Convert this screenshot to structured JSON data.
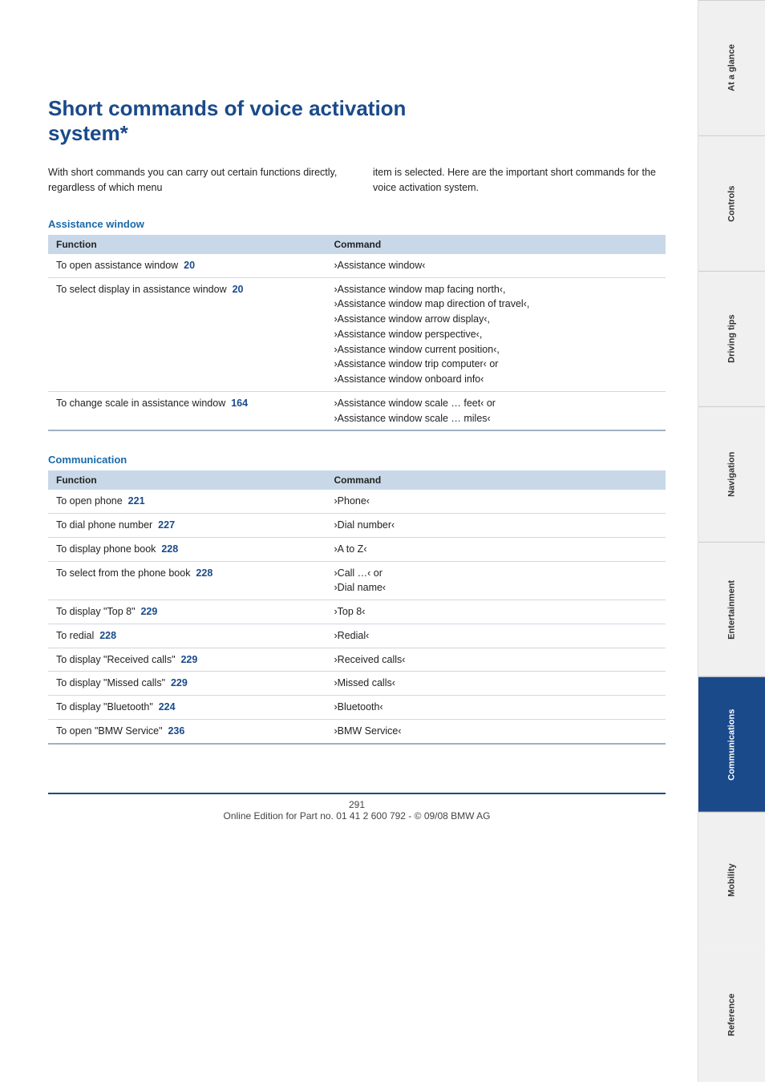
{
  "page": {
    "title_line1": "Short commands of voice activation",
    "title_line2": "system*",
    "intro_left": "With short commands you can carry out certain functions directly, regardless of which menu",
    "intro_right": "item is selected. Here are the important short commands for the voice activation system.",
    "footer_page": "291",
    "footer_text": "Online Edition for Part no. 01 41 2 600 792 - © 09/08 BMW AG"
  },
  "sections": [
    {
      "id": "assistance-window",
      "title": "Assistance window",
      "col_function": "Function",
      "col_command": "Command",
      "rows": [
        {
          "function": "To open assistance window",
          "page": "20",
          "command": "›Assistance window‹"
        },
        {
          "function": "To select display in assistance window",
          "page": "20",
          "command": "›Assistance window map facing north‹,\n›Assistance window map direction of travel‹,\n›Assistance window arrow display‹,\n›Assistance window perspective‹,\n›Assistance window current position‹,\n›Assistance window trip computer‹ or\n›Assistance window onboard info‹"
        },
        {
          "function": "To change scale in assistance window",
          "page": "164",
          "command": "›Assistance window scale … feet‹ or\n›Assistance window scale … miles‹"
        }
      ]
    },
    {
      "id": "communication",
      "title": "Communication",
      "col_function": "Function",
      "col_command": "Command",
      "rows": [
        {
          "function": "To open phone",
          "page": "221",
          "command": "›Phone‹"
        },
        {
          "function": "To dial phone number",
          "page": "227",
          "command": "›Dial number‹"
        },
        {
          "function": "To display phone book",
          "page": "228",
          "command": "›A to Z‹"
        },
        {
          "function": "To select from the phone book",
          "page": "228",
          "command": "›Call …‹ or\n›Dial name‹"
        },
        {
          "function": "To display \"Top 8\"",
          "page": "229",
          "command": "›Top 8‹"
        },
        {
          "function": "To redial",
          "page": "228",
          "command": "›Redial‹"
        },
        {
          "function": "To display \"Received calls\"",
          "page": "229",
          "command": "›Received calls‹"
        },
        {
          "function": "To display \"Missed calls\"",
          "page": "229",
          "command": "›Missed calls‹"
        },
        {
          "function": "To display \"Bluetooth\"",
          "page": "224",
          "command": "›Bluetooth‹"
        },
        {
          "function": "To open \"BMW Service\"",
          "page": "236",
          "command": "›BMW Service‹"
        }
      ]
    }
  ],
  "sidebar": {
    "tabs": [
      {
        "id": "at-a-glance",
        "label": "At a glance",
        "active": false
      },
      {
        "id": "controls",
        "label": "Controls",
        "active": false
      },
      {
        "id": "driving-tips",
        "label": "Driving tips",
        "active": false
      },
      {
        "id": "navigation",
        "label": "Navigation",
        "active": false
      },
      {
        "id": "entertainment",
        "label": "Entertainment",
        "active": false
      },
      {
        "id": "communications",
        "label": "Communications",
        "active": true
      },
      {
        "id": "mobility",
        "label": "Mobility",
        "active": false
      },
      {
        "id": "reference",
        "label": "Reference",
        "active": false
      }
    ]
  }
}
